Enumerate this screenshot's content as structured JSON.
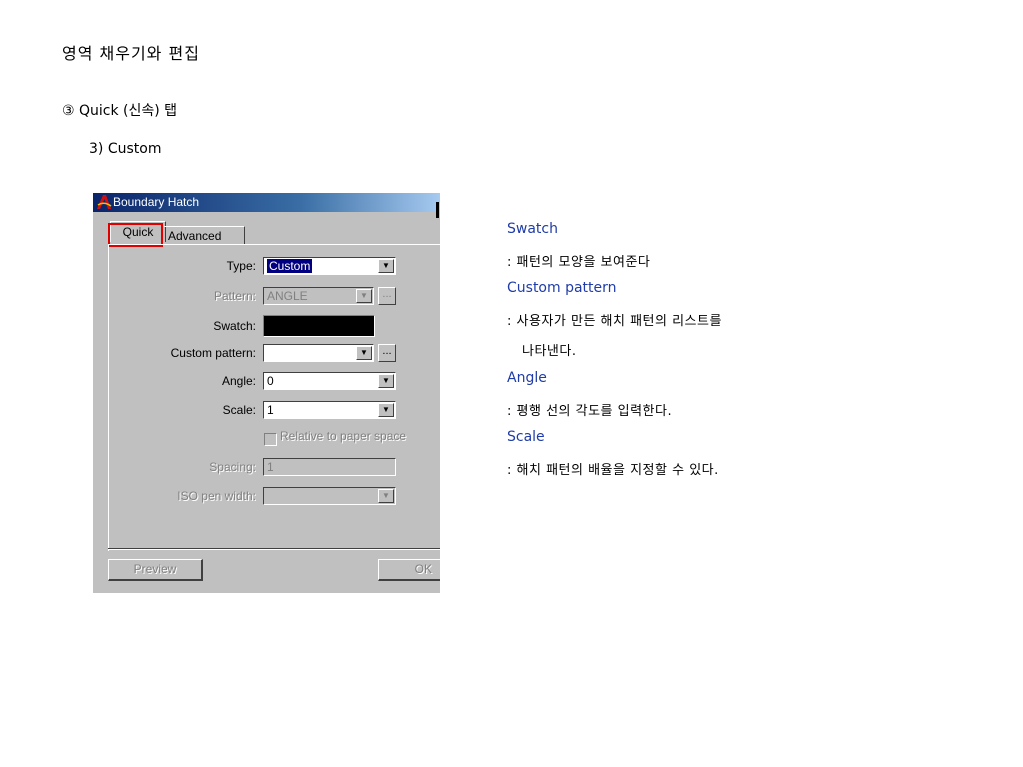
{
  "heading": "영역 채우기와 편집",
  "section": "③ Quick (신속) 탭",
  "subsection": "3) Custom",
  "dialog": {
    "title": "Boundary Hatch",
    "tabs": {
      "quick": "Quick",
      "advanced": "Advanced"
    },
    "type_label": "Type:",
    "type_value": "Custom",
    "pattern_label": "Pattern:",
    "pattern_value": "ANGLE",
    "swatch_label": "Swatch:",
    "custom_pattern_label": "Custom pattern:",
    "custom_pattern_value": "",
    "angle_label": "Angle:",
    "angle_value": "0",
    "scale_label": "Scale:",
    "scale_value": "1",
    "relative_label": "Relative to paper space",
    "spacing_label": "Spacing:",
    "spacing_value": "1",
    "iso_label": "ISO pen width:",
    "iso_value": "",
    "ellipsis": "...",
    "preview_button": "Preview",
    "ok_button": "OK",
    "highlight_color": "#e00000"
  },
  "notes": [
    {
      "head": "Swatch",
      "lines": [
        ": 패턴의 모양을 보여준다"
      ]
    },
    {
      "head": "Custom pattern",
      "lines": [
        ": 사용자가 만든 해치 패턴의 리스트를",
        "나타낸다."
      ]
    },
    {
      "head": "Angle",
      "lines": [
        ": 평행 선의 각도를 입력한다."
      ]
    },
    {
      "head": "Scale",
      "lines": [
        ": 해치 패턴의 배율을 지정할 수 있다."
      ]
    }
  ]
}
